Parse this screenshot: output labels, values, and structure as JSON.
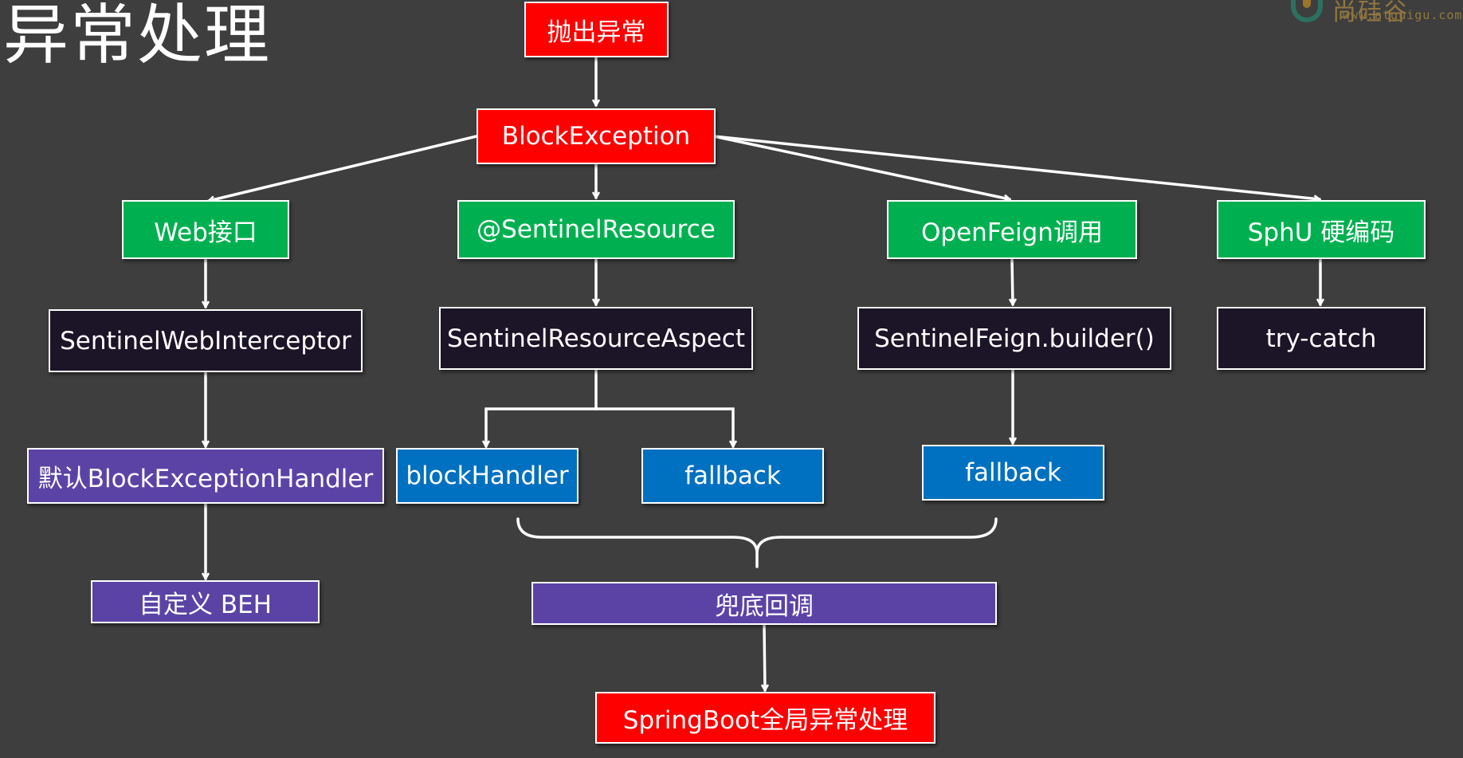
{
  "title": "异常处理",
  "logo": {
    "mark": "尚硅谷",
    "url": "www.atguigu.com"
  },
  "nodes": {
    "throw": "抛出异常",
    "block_exception": "BlockException",
    "web": "Web接口",
    "sentinel_resource": "@SentinelResource",
    "openfeign": "OpenFeign调用",
    "sphu": "SphU 硬编码",
    "web_interceptor": "SentinelWebInterceptor",
    "resource_aspect": "SentinelResourceAspect",
    "feign_builder": "SentinelFeign.builder()",
    "try_catch": "try-catch",
    "default_handler": "默认BlockExceptionHandler",
    "block_handler": "blockHandler",
    "fallback_aspect": "fallback",
    "fallback_feign": "fallback",
    "custom_beh": "自定义 BEH",
    "fallback_callback": "兜底回调",
    "springboot_handler": "SpringBoot全局异常处理"
  },
  "colors": {
    "background": "#3e3e3e",
    "red": "#ff0000",
    "green": "#00b050",
    "dark": "#1c1427",
    "blue": "#0070c0",
    "purple": "#5b43a6",
    "line": "#ffffff"
  }
}
